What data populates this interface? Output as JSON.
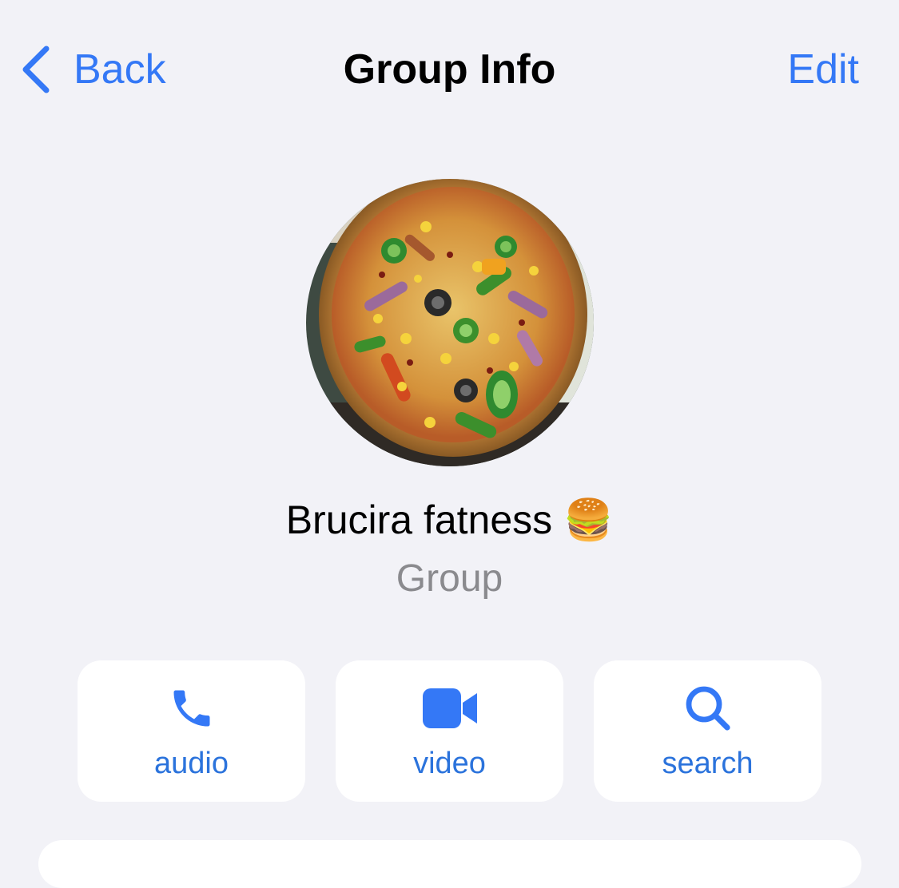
{
  "nav": {
    "back_label": "Back",
    "title": "Group Info",
    "edit_label": "Edit"
  },
  "group": {
    "name": "Brucira fatness 🍔",
    "subtitle": "Group"
  },
  "actions": [
    {
      "label": "audio",
      "icon": "phone-icon"
    },
    {
      "label": "video",
      "icon": "video-camera-icon"
    },
    {
      "label": "search",
      "icon": "search-icon"
    }
  ],
  "colors": {
    "accent": "#3478f6",
    "background": "#f2f2f7",
    "card": "#ffffff",
    "secondary_text": "#8a8a8e"
  }
}
